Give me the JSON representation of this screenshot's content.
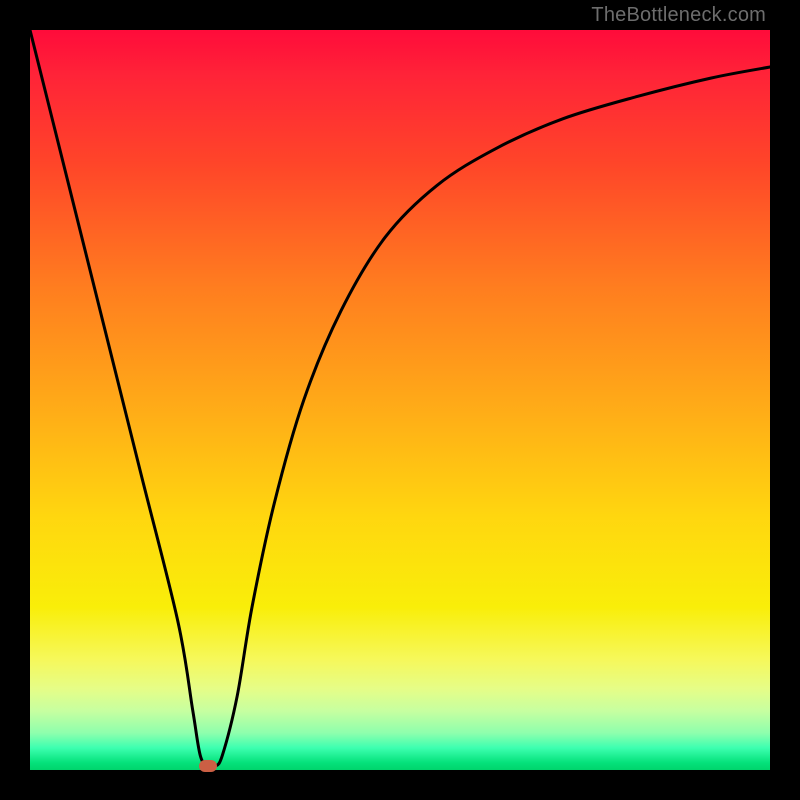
{
  "watermark": "TheBottleneck.com",
  "chart_data": {
    "type": "line",
    "title": "",
    "xlabel": "",
    "ylabel": "",
    "xlim": [
      0,
      100
    ],
    "ylim": [
      0,
      100
    ],
    "grid": false,
    "legend": false,
    "series": [
      {
        "name": "bottleneck-curve",
        "x": [
          0,
          5,
          10,
          15,
          20,
          22,
          23,
          24,
          25,
          26,
          28,
          30,
          33,
          37,
          42,
          48,
          55,
          63,
          72,
          82,
          92,
          100
        ],
        "y": [
          100,
          80,
          60,
          40,
          20,
          8,
          2,
          0.5,
          0.5,
          2,
          10,
          22,
          36,
          50,
          62,
          72,
          79,
          84,
          88,
          91,
          93.5,
          95
        ]
      }
    ],
    "marker": {
      "x": 24,
      "y": 0.5,
      "color": "#cb5f44"
    },
    "colors": {
      "gradient_top": "#ff0b3a",
      "gradient_bottom": "#00d46c",
      "curve": "#000000",
      "background_frame": "#000000"
    }
  }
}
